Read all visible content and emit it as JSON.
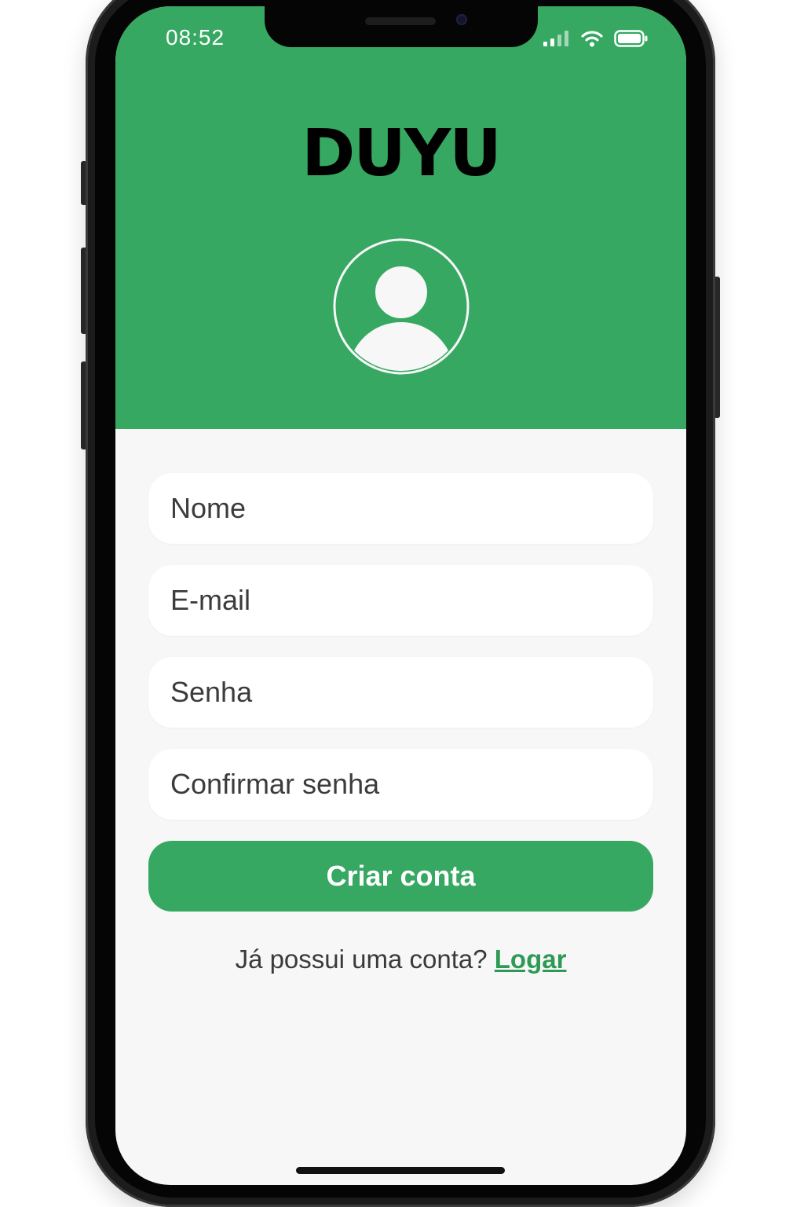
{
  "status_bar": {
    "time": "08:52",
    "icons": [
      "cellular-signal-icon",
      "wifi-icon",
      "battery-icon"
    ]
  },
  "header": {
    "brand": "DUYU",
    "avatar_icon": "user-avatar-icon"
  },
  "form": {
    "name_placeholder": "Nome",
    "email_placeholder": "E-mail",
    "password_placeholder": "Senha",
    "confirm_password_placeholder": "Confirmar senha",
    "submit_label": "Criar conta"
  },
  "footer": {
    "prompt": "Já possui uma conta?",
    "login_label": "Logar"
  },
  "colors": {
    "primary_green": "#36a862",
    "link_green": "#2e9a56",
    "screen_background": "#f7f7f7",
    "field_background": "#ffffff"
  }
}
